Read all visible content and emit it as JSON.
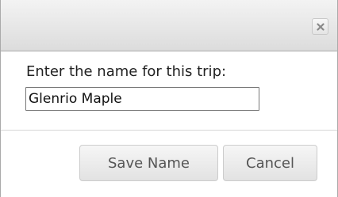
{
  "dialog": {
    "close_icon": "close-icon",
    "prompt": "Enter the name for this trip:",
    "name_value": "Glenrio Maple",
    "save_label": "Save Name",
    "cancel_label": "Cancel"
  },
  "colors": {
    "titlebar": "#e6e6e6",
    "border": "#aaaaaa",
    "button_text": "#555555",
    "divider": "#d6d6d6"
  }
}
